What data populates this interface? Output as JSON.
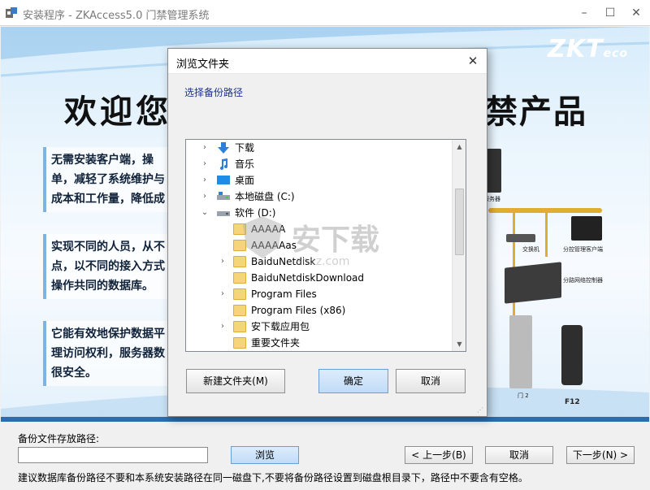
{
  "window": {
    "title": "安装程序 - ZKAccess5.0 门禁管理系统",
    "minimize": "–",
    "maximize": "☐",
    "close": "✕"
  },
  "banner": {
    "logo": "ZKT",
    "logo_suffix": "eco",
    "headline_left": "欢迎您",
    "headline_right": "禁产品",
    "paragraphs": [
      "无需安装客户端，操单，减轻了系统维护与成本和工作量，降低成",
      "实现不同的人员，从不点，以不同的接入方式操作共同的数据库。",
      "它能有效地保护数据平理访问权利，服务器数很安全。"
    ],
    "diagram_labels": [
      "服务器",
      "交换机",
      "分控管理客户端",
      "分路网络控制器",
      "门 2",
      "F12"
    ]
  },
  "bottom": {
    "path_label": "备份文件存放路径:",
    "path_value": "",
    "browse_label": "浏览",
    "prev_label": "< 上一步(B)",
    "cancel_label": "取消",
    "next_label": "下一步(N) >",
    "hint": "建议数据库备份路径不要和本系统安装路径在同一磁盘下,不要将备份路径设置到磁盘根目录下，路径中不要含有空格。"
  },
  "dialog": {
    "title": "浏览文件夹",
    "description": "选择备份路径",
    "tree": [
      {
        "label": "下载",
        "icon": "download-icon",
        "expander": "›"
      },
      {
        "label": "音乐",
        "icon": "music-icon",
        "expander": "›"
      },
      {
        "label": "桌面",
        "icon": "desktop-icon",
        "expander": "›"
      },
      {
        "label": "本地磁盘 (C:)",
        "icon": "drive-icon",
        "expander": "›"
      },
      {
        "label": "软件 (D:)",
        "icon": "drive-icon",
        "expander": "⌄"
      },
      {
        "label": "AAAAA",
        "icon": "folder-icon",
        "expander": ""
      },
      {
        "label": "AAAAAas",
        "icon": "folder-icon",
        "expander": ""
      },
      {
        "label": "BaiduNetdisk",
        "icon": "folder-icon",
        "expander": "›"
      },
      {
        "label": "BaiduNetdiskDownload",
        "icon": "folder-icon",
        "expander": ""
      },
      {
        "label": "Program Files",
        "icon": "folder-icon",
        "expander": "›"
      },
      {
        "label": "Program Files (x86)",
        "icon": "folder-icon",
        "expander": ""
      },
      {
        "label": "安下载应用包",
        "icon": "folder-icon",
        "expander": "›"
      },
      {
        "label": "重要文件夹",
        "icon": "folder-icon",
        "expander": ""
      }
    ],
    "new_folder_label": "新建文件夹(M)",
    "ok_label": "确定",
    "cancel_label": "取消"
  },
  "watermark": {
    "text": "安下载",
    "sub": "anxz.com"
  },
  "colors": {
    "accent": "#2a6eb0",
    "selection": "#e5f3fb",
    "folder": "#f6d47a",
    "dialog_desc": "#1e3287"
  }
}
